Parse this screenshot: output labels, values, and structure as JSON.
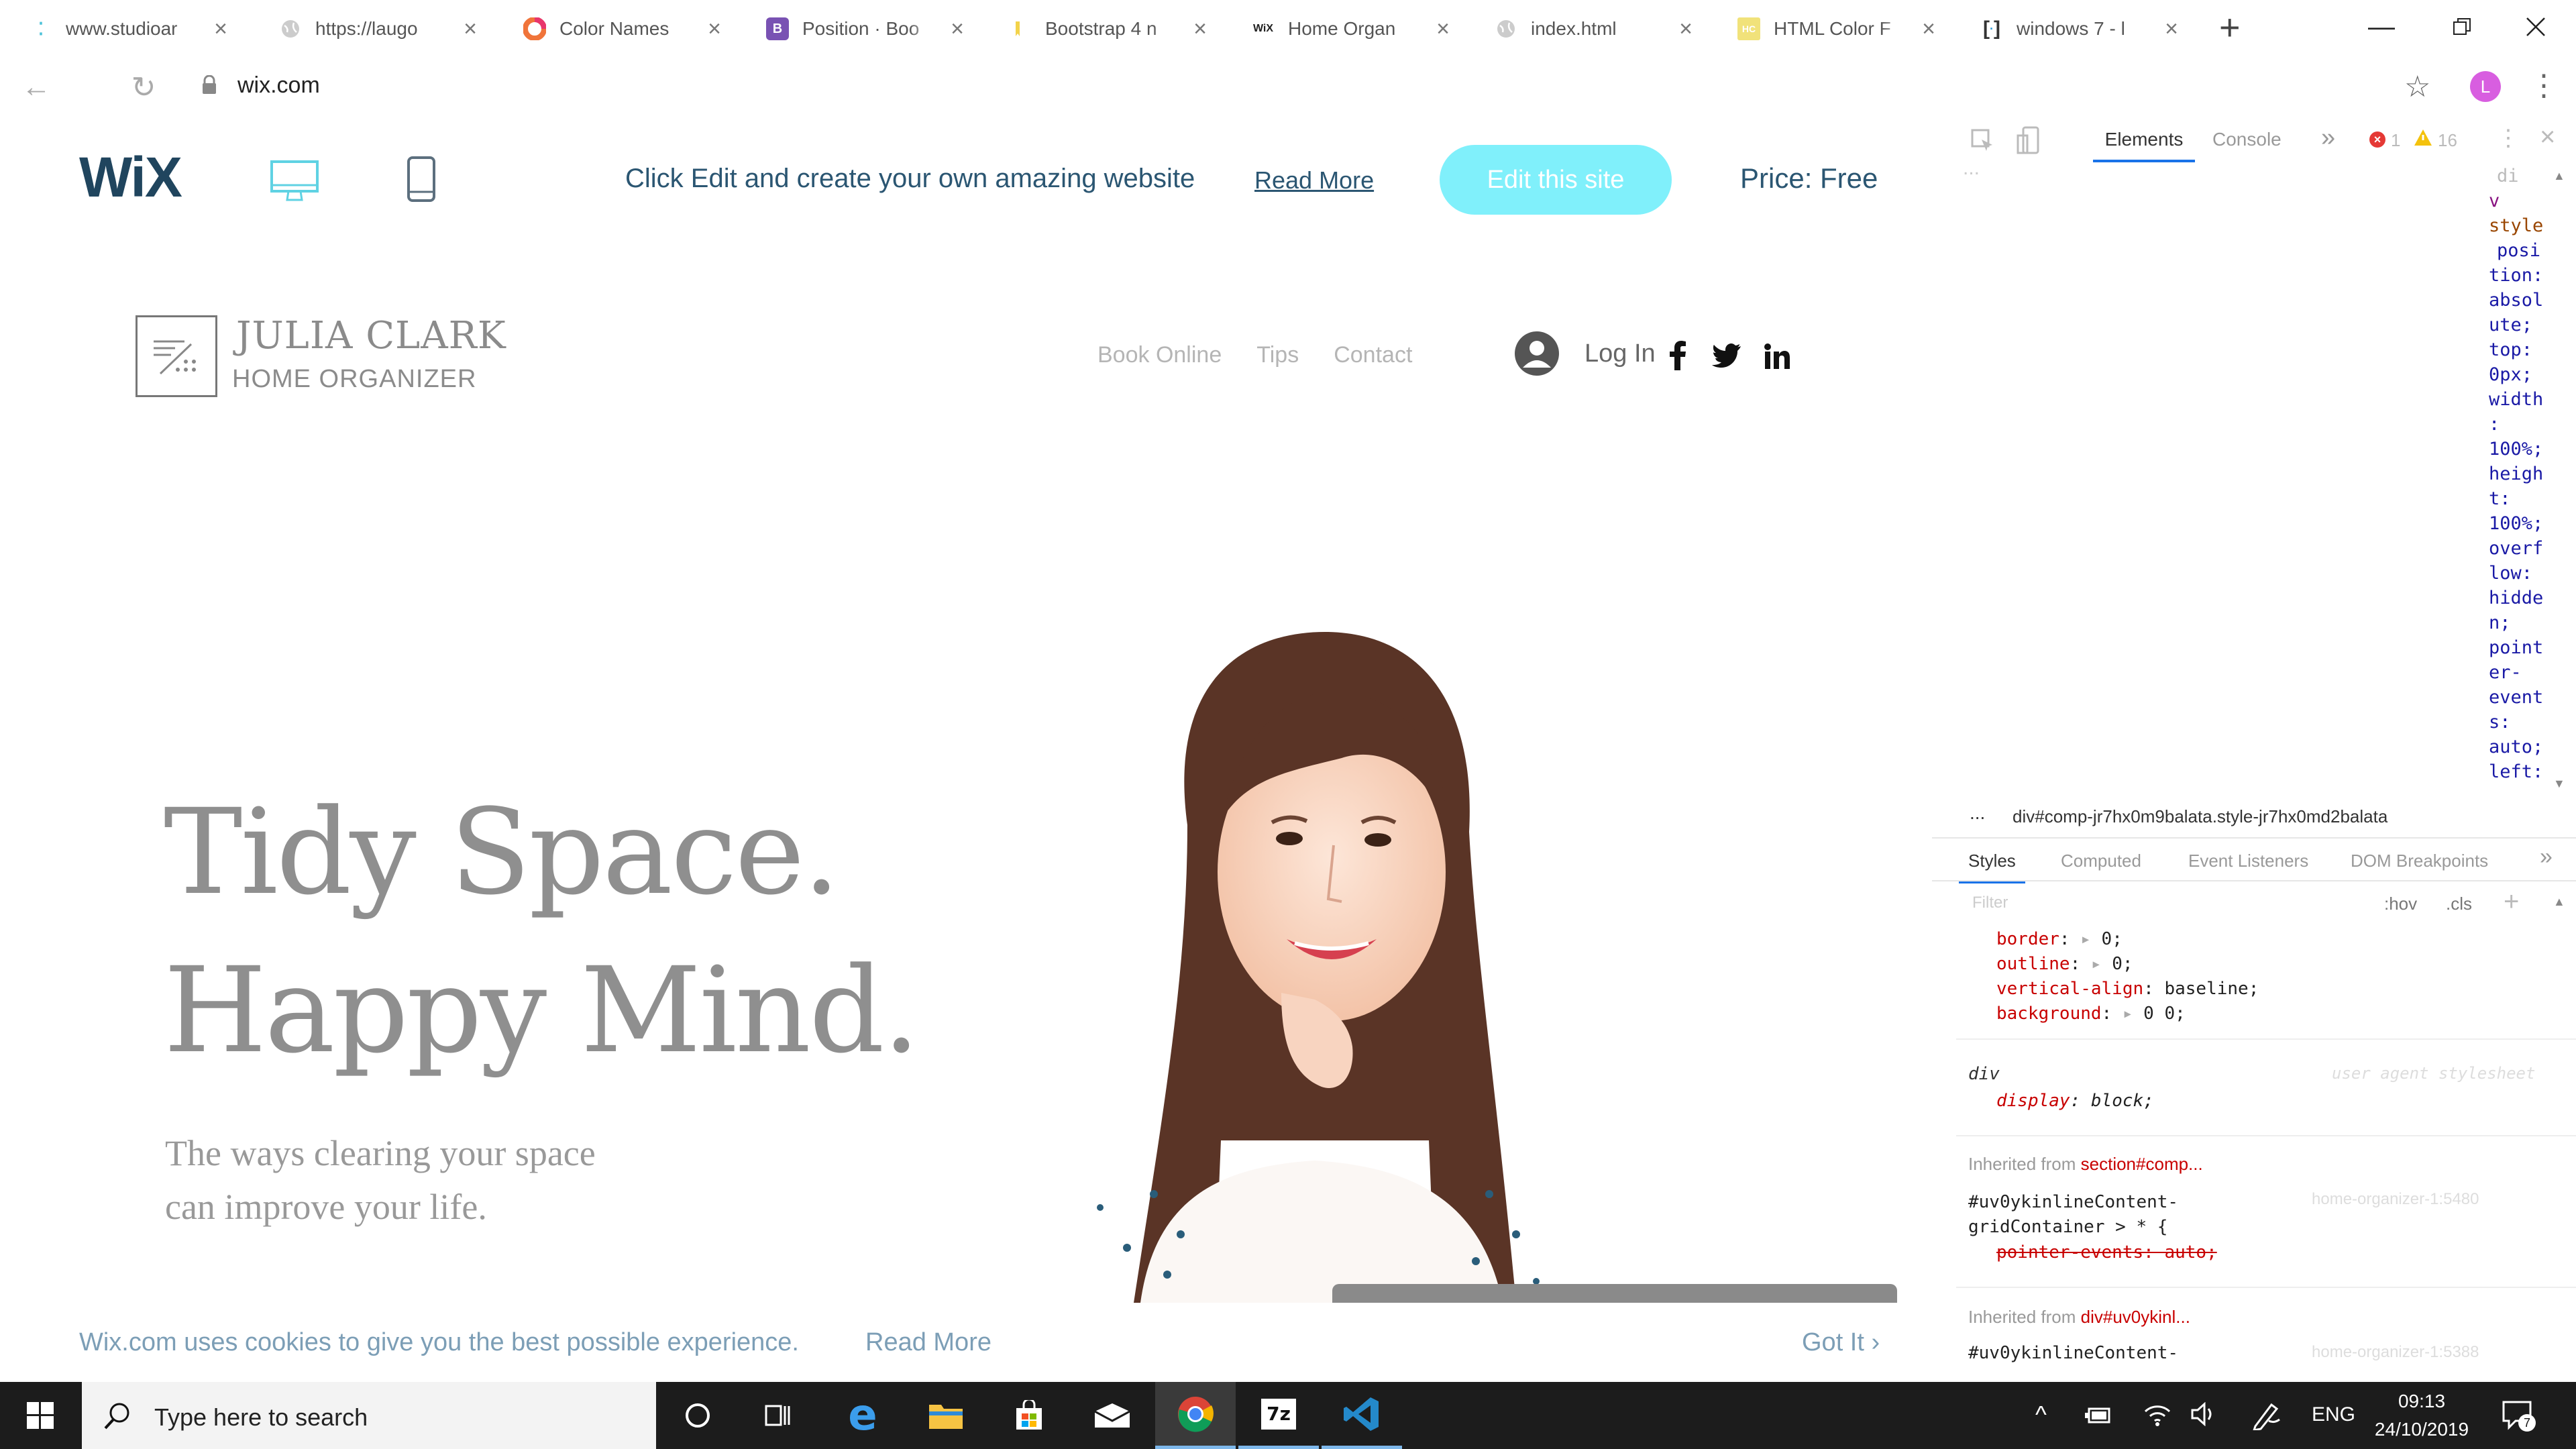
{
  "browser": {
    "tabs": [
      {
        "title": "www.studioar"
      },
      {
        "title": "https://laugo"
      },
      {
        "title": "Color Names"
      },
      {
        "title": "Position · Boo"
      },
      {
        "title": "Bootstrap 4 n"
      },
      {
        "title": "Home Organ"
      },
      {
        "title": "index.html"
      },
      {
        "title": "HTML Color F"
      },
      {
        "title": "windows 7 - l"
      }
    ],
    "new_tab": "+",
    "url": "wix.com",
    "profile_initial": "L"
  },
  "wix_banner": {
    "logo": "WiX",
    "message": "Click Edit and create your own amazing website",
    "read_more": "Read More",
    "edit_button": "Edit this site",
    "price": "Price: Free"
  },
  "site": {
    "brand_name": "JULIA CLARK",
    "brand_sub": "HOME ORGANIZER",
    "menu": [
      "Book Online",
      "Tips",
      "Contact"
    ],
    "login": "Log In",
    "headline_1": "Tidy Space.",
    "headline_2": "Happy Mind.",
    "sub_1": "The ways clearing your space",
    "sub_2": "can improve your life.",
    "cookie_text": "Wix.com uses cookies to give you the best possible experience.",
    "cookie_link": "Read More",
    "cookie_button": "Got It"
  },
  "devtools": {
    "tab_elements": "Elements",
    "tab_console": "Console",
    "more_tabs": "»",
    "error_count": "1",
    "warning_count": "16",
    "dom_lines": [
      "di",
      "v",
      "style",
      "",
      "posi",
      "tion:",
      "absol",
      "ute;",
      "top:",
      "0px;",
      "width",
      ":",
      "100%;",
      "heigh",
      "t:",
      "100%;",
      "overf",
      "low:",
      "hidde",
      "n;",
      "point",
      "er-",
      "event",
      "s:",
      "auto;",
      "left:"
    ],
    "breadcrumb_dots": "...",
    "breadcrumb": "div#comp-jr7hx0m9balata.style-jr7hx0md2balata",
    "panel_tabs": [
      "Styles",
      "Computed",
      "Event Listeners",
      "DOM Breakpoints"
    ],
    "filter_placeholder": "Filter",
    "hov": ":hov",
    "cls": ".cls",
    "rules": [
      {
        "prop": "border",
        "value": "0;"
      },
      {
        "prop": "outline",
        "value": "0;"
      },
      {
        "prop": "vertical-align",
        "value": "baseline;"
      },
      {
        "prop": "background",
        "value": "0 0;"
      }
    ],
    "div_selector": "div",
    "div_source": "user agent stylesheet",
    "div_prop": "display",
    "div_value": "block;",
    "inherited_1_label": "Inherited from",
    "inherited_1_link": "section#comp...",
    "selector_2a": "#uv0ykinlineContent-",
    "selector_2b": "gridContainer > * {",
    "source_2": "home-organizer-1:5480",
    "strike_prop": "pointer-events: auto;",
    "inherited_2_label": "Inherited from",
    "inherited_2_link": "div#uv0ykinl...",
    "selector_3": "#uv0ykinlineContent-",
    "source_3": "home-organizer-1:5388"
  },
  "taskbar": {
    "search_placeholder": "Type here to search",
    "language": "ENG",
    "time": "09:13",
    "date": "24/10/2019",
    "notification_count": "7"
  }
}
